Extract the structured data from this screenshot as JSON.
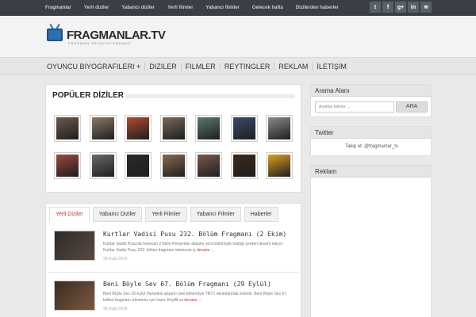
{
  "topbar": {
    "links": [
      "Fragmanlar",
      "Yerli diziler",
      "Yabancı diziler",
      "Yerli filmler",
      "Yabancı filmler",
      "Gelecek hafta",
      "Dizilerden haberler"
    ],
    "social": [
      "twitter-icon",
      "facebook-icon",
      "googleplus-icon",
      "linkedin-icon",
      "rss-icon"
    ],
    "social_glyphs": [
      "t",
      "f",
      "g+",
      "in",
      "≋"
    ]
  },
  "header": {
    "logo_text": "FRAGMANLAR.TV",
    "tagline": "FRAGMAN TELEVIZYONUNUZ"
  },
  "mainnav": [
    "OYUNCU BIYOGRAFILERI +",
    "DIZILER",
    "FILMLER",
    "REYTINGLER",
    "REKLAM",
    "İLETİŞİM"
  ],
  "popular": {
    "title": "POPÜLER DİZİLER",
    "thumb_colors": [
      "#6b5a4e",
      "#8a7a68",
      "#b34a2e",
      "#7a6a5a",
      "#5a7a6e",
      "#3a4a6a",
      "#8a8a8a",
      "#9a4a3a",
      "#6a6a6a",
      "#2a2a2a",
      "#8a6a4e",
      "#7a5a4e",
      "#3a2a1e",
      "#d8a020"
    ]
  },
  "tabs": [
    "Yerli Diziler",
    "Yabancı Diziler",
    "Yerli Filmler",
    "Yabancı Filmler",
    "Haberler"
  ],
  "articles": [
    {
      "title": "Kurtlar Vadisi Pusu 232. Bölüm Fragmanı (2 Ekim)",
      "desc": "Kurtlar Vadisi Pusu'da heyecan 2 Ekim Perşembe akşamı yeni bölümüyle kaldığı yerden devam ediyor. Kurtlar Vadisi Pusu 232. bölüm fragmanı izlemeniz iç",
      "more": "devamı",
      "date": "28 Eylül 2014"
    },
    {
      "title": "Beni Böyle Sev 67. Bölüm Fragmanı (29 Eylül)",
      "desc": "Beni Böyle Sev 29 Eylül Pazartesi akşamı yeni bölümüyle TRT1 ekranlarında sizlerle. Beni Böyle Sev 67. bölüm fragmanı izlemeniz için hazır. Keyifli sa",
      "more": "devamı",
      "date": "28 Eylül 2014"
    }
  ],
  "sidebar": {
    "search_title": "Arama Alanı",
    "search_placeholder": "Anahtar kelime ...",
    "search_button": "ARA",
    "twitter_title": "Twitter",
    "twitter_text": "Takip et: @fragmanlar_tv",
    "ad_title": "Reklam"
  }
}
